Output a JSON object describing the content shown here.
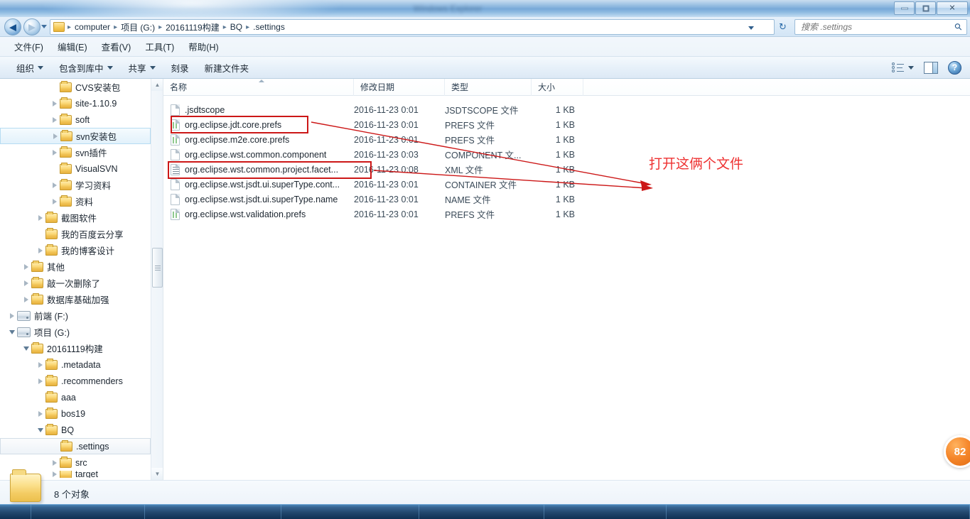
{
  "window": {
    "title_blurred": "Windows Explorer",
    "minimize_label": "最小化",
    "restore_label": "还原",
    "close_label": "关闭"
  },
  "address_bar": {
    "folder_icon": "folder-icon",
    "crumbs": [
      "computer",
      "项目 (G:)",
      "20161119构建",
      "BQ",
      ".settings"
    ],
    "separator": "▶",
    "history_dropdown": "history-dropdown",
    "refresh_icon": "refresh-icon"
  },
  "search": {
    "placeholder": "搜索 .settings",
    "value": "",
    "icon": "search-icon"
  },
  "menu": {
    "items": [
      {
        "label": "文件(F)"
      },
      {
        "label": "编辑(E)"
      },
      {
        "label": "查看(V)"
      },
      {
        "label": "工具(T)"
      },
      {
        "label": "帮助(H)"
      }
    ]
  },
  "toolbar": {
    "items": [
      {
        "label": "组织",
        "caret": true
      },
      {
        "label": "包含到库中",
        "caret": true
      },
      {
        "label": "共享",
        "caret": true
      },
      {
        "label": "刻录",
        "caret": false
      },
      {
        "label": "新建文件夹",
        "caret": false
      }
    ],
    "views_icon": "view-options-icon",
    "views_caret": "chevron-down-icon",
    "preview_pane_icon": "preview-pane-icon",
    "help_icon": "help-icon",
    "help_glyph": "?"
  },
  "nav_tree": {
    "items": [
      {
        "label": "CVS安装包",
        "indent": 3,
        "twisty": "none",
        "icon": "folder-icon",
        "state": "normal"
      },
      {
        "label": "site-1.10.9",
        "indent": 3,
        "twisty": "collapsed",
        "icon": "folder-icon",
        "state": "normal"
      },
      {
        "label": "soft",
        "indent": 3,
        "twisty": "collapsed",
        "icon": "folder-icon",
        "state": "normal"
      },
      {
        "label": "svn安装包",
        "indent": 3,
        "twisty": "collapsed",
        "icon": "folder-icon",
        "state": "hover"
      },
      {
        "label": "svn插件",
        "indent": 3,
        "twisty": "collapsed",
        "icon": "folder-icon",
        "state": "normal"
      },
      {
        "label": "VisualSVN",
        "indent": 3,
        "twisty": "none",
        "icon": "folder-icon",
        "state": "normal"
      },
      {
        "label": "学习资料",
        "indent": 3,
        "twisty": "collapsed",
        "icon": "folder-icon",
        "state": "normal"
      },
      {
        "label": "资料",
        "indent": 3,
        "twisty": "collapsed",
        "icon": "folder-icon",
        "state": "normal"
      },
      {
        "label": "截图软件",
        "indent": 2,
        "twisty": "collapsed",
        "icon": "folder-icon",
        "state": "normal"
      },
      {
        "label": "我的百度云分享",
        "indent": 2,
        "twisty": "none",
        "icon": "folder-icon",
        "state": "normal"
      },
      {
        "label": "我的博客设计",
        "indent": 2,
        "twisty": "collapsed",
        "icon": "folder-icon",
        "state": "normal"
      },
      {
        "label": "其他",
        "indent": 1,
        "twisty": "collapsed",
        "icon": "folder-icon",
        "state": "normal"
      },
      {
        "label": "敲一次删除了",
        "indent": 1,
        "twisty": "collapsed",
        "icon": "folder-icon",
        "state": "normal"
      },
      {
        "label": "数据库基础加强",
        "indent": 1,
        "twisty": "collapsed",
        "icon": "folder-icon",
        "state": "normal"
      },
      {
        "label": "前端 (F:)",
        "indent": 0,
        "twisty": "collapsed",
        "icon": "drive-icon",
        "state": "normal"
      },
      {
        "label": "项目 (G:)",
        "indent": 0,
        "twisty": "expanded",
        "icon": "drive-icon",
        "state": "normal"
      },
      {
        "label": "20161119构建",
        "indent": 1,
        "twisty": "expanded",
        "icon": "folder-icon",
        "state": "normal"
      },
      {
        "label": ".metadata",
        "indent": 2,
        "twisty": "collapsed",
        "icon": "folder-icon",
        "state": "normal"
      },
      {
        "label": ".recommenders",
        "indent": 2,
        "twisty": "collapsed",
        "icon": "folder-icon",
        "state": "normal"
      },
      {
        "label": "aaa",
        "indent": 2,
        "twisty": "none",
        "icon": "folder-icon",
        "state": "normal"
      },
      {
        "label": "bos19",
        "indent": 2,
        "twisty": "collapsed",
        "icon": "folder-icon",
        "state": "normal"
      },
      {
        "label": "BQ",
        "indent": 2,
        "twisty": "expanded",
        "icon": "folder-icon",
        "state": "normal"
      },
      {
        "label": ".settings",
        "indent": 3,
        "twisty": "none",
        "icon": "folder-icon",
        "state": "selected"
      },
      {
        "label": "src",
        "indent": 3,
        "twisty": "collapsed",
        "icon": "folder-icon",
        "state": "normal"
      },
      {
        "label": "target",
        "indent": 3,
        "twisty": "collapsed",
        "icon": "folder-icon",
        "state": "clipped"
      }
    ],
    "scroll_up_glyph": "▲",
    "scroll_down_glyph": "▼"
  },
  "file_list": {
    "columns": [
      {
        "label": "名称",
        "sorted": true
      },
      {
        "label": "修改日期",
        "sorted": false
      },
      {
        "label": "类型",
        "sorted": false
      },
      {
        "label": "大小",
        "sorted": false
      }
    ],
    "rows": [
      {
        "name": ".jsdtscope",
        "date": "2016-11-23 0:01",
        "type": "JSDTSCOPE 文件",
        "size": "1 KB",
        "icon": "blank-file-icon"
      },
      {
        "name": "org.eclipse.jdt.core.prefs",
        "date": "2016-11-23 0:01",
        "type": "PREFS 文件",
        "size": "1 KB",
        "icon": "prefs-file-icon"
      },
      {
        "name": "org.eclipse.m2e.core.prefs",
        "date": "2016-11-23 0:01",
        "type": "PREFS 文件",
        "size": "1 KB",
        "icon": "prefs-file-icon"
      },
      {
        "name": "org.eclipse.wst.common.component",
        "date": "2016-11-23 0:03",
        "type": "COMPONENT 文...",
        "size": "1 KB",
        "icon": "blank-file-icon"
      },
      {
        "name": "org.eclipse.wst.common.project.facet...",
        "date": "2016-11-23 0:08",
        "type": "XML 文件",
        "size": "1 KB",
        "icon": "xml-file-icon"
      },
      {
        "name": "org.eclipse.wst.jsdt.ui.superType.cont...",
        "date": "2016-11-23 0:01",
        "type": "CONTAINER 文件",
        "size": "1 KB",
        "icon": "blank-file-icon"
      },
      {
        "name": "org.eclipse.wst.jsdt.ui.superType.name",
        "date": "2016-11-23 0:01",
        "type": "NAME 文件",
        "size": "1 KB",
        "icon": "blank-file-icon"
      },
      {
        "name": "org.eclipse.wst.validation.prefs",
        "date": "2016-11-23 0:01",
        "type": "PREFS 文件",
        "size": "1 KB",
        "icon": "prefs-file-icon"
      }
    ]
  },
  "annotation": {
    "text": "打开这俩个文件",
    "color": "#ee3131",
    "box_color": "#cc1717",
    "boxes": [
      {
        "target": "org.eclipse.jdt.core.prefs"
      },
      {
        "target": "org.eclipse.wst.common.project.facet..."
      }
    ]
  },
  "status_bar": {
    "text": "8 个对象",
    "folder_icon": "large-folder-icon"
  },
  "badge": {
    "value": "82",
    "color": "#f5862a"
  }
}
